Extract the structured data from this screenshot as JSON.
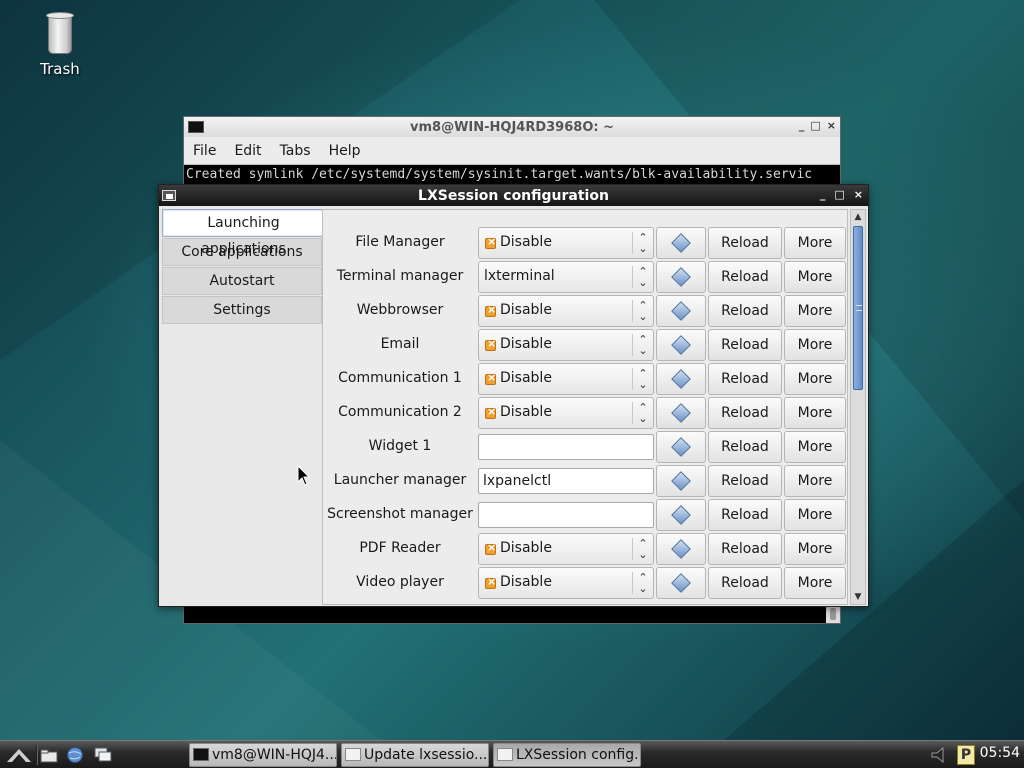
{
  "desktop": {
    "trash_label": "Trash"
  },
  "terminal": {
    "title": "vm8@WIN-HQJ4RD3968O: ~",
    "menu": [
      "File",
      "Edit",
      "Tabs",
      "Help"
    ],
    "output_line": "Created symlink /etc/systemd/system/sysinit.target.wants/blk-availability.servic",
    "window_buttons": [
      "_",
      "□",
      "×"
    ]
  },
  "dialog": {
    "title": "LXSession configuration",
    "window_buttons": [
      "_",
      "□",
      "×"
    ],
    "tabs": [
      "Launching applications",
      "Core applications",
      "Autostart",
      "Settings"
    ],
    "active_tab": "Launching applications",
    "rows": [
      {
        "label": "File Manager",
        "kind": "combo",
        "value": "Disable",
        "icon": true
      },
      {
        "label": "Terminal manager",
        "kind": "combo",
        "value": "lxterminal",
        "icon": false
      },
      {
        "label": "Webbrowser",
        "kind": "combo",
        "value": "Disable",
        "icon": true
      },
      {
        "label": "Email",
        "kind": "combo",
        "value": "Disable",
        "icon": true
      },
      {
        "label": "Communication 1",
        "kind": "combo",
        "value": "Disable",
        "icon": true
      },
      {
        "label": "Communication 2",
        "kind": "combo",
        "value": "Disable",
        "icon": true
      },
      {
        "label": "Widget 1",
        "kind": "entry",
        "value": ""
      },
      {
        "label": "Launcher manager",
        "kind": "entry",
        "value": "lxpanelctl"
      },
      {
        "label": "Screenshot manager",
        "kind": "entry",
        "value": ""
      },
      {
        "label": "PDF Reader",
        "kind": "combo",
        "value": "Disable",
        "icon": true
      },
      {
        "label": "Video player",
        "kind": "combo",
        "value": "Disable",
        "icon": true
      }
    ],
    "reload_label": "Reload",
    "more_label": "More",
    "scroll_arrows": {
      "up": "▲",
      "down": "▼"
    }
  },
  "taskbar": {
    "tasks": [
      {
        "label": "vm8@WIN-HQJ4...",
        "active": false
      },
      {
        "label": "Update lxsessio...",
        "active": false
      },
      {
        "label": "LXSession config...",
        "active": true
      }
    ],
    "tray_badge": "P",
    "clock": "05:54"
  }
}
